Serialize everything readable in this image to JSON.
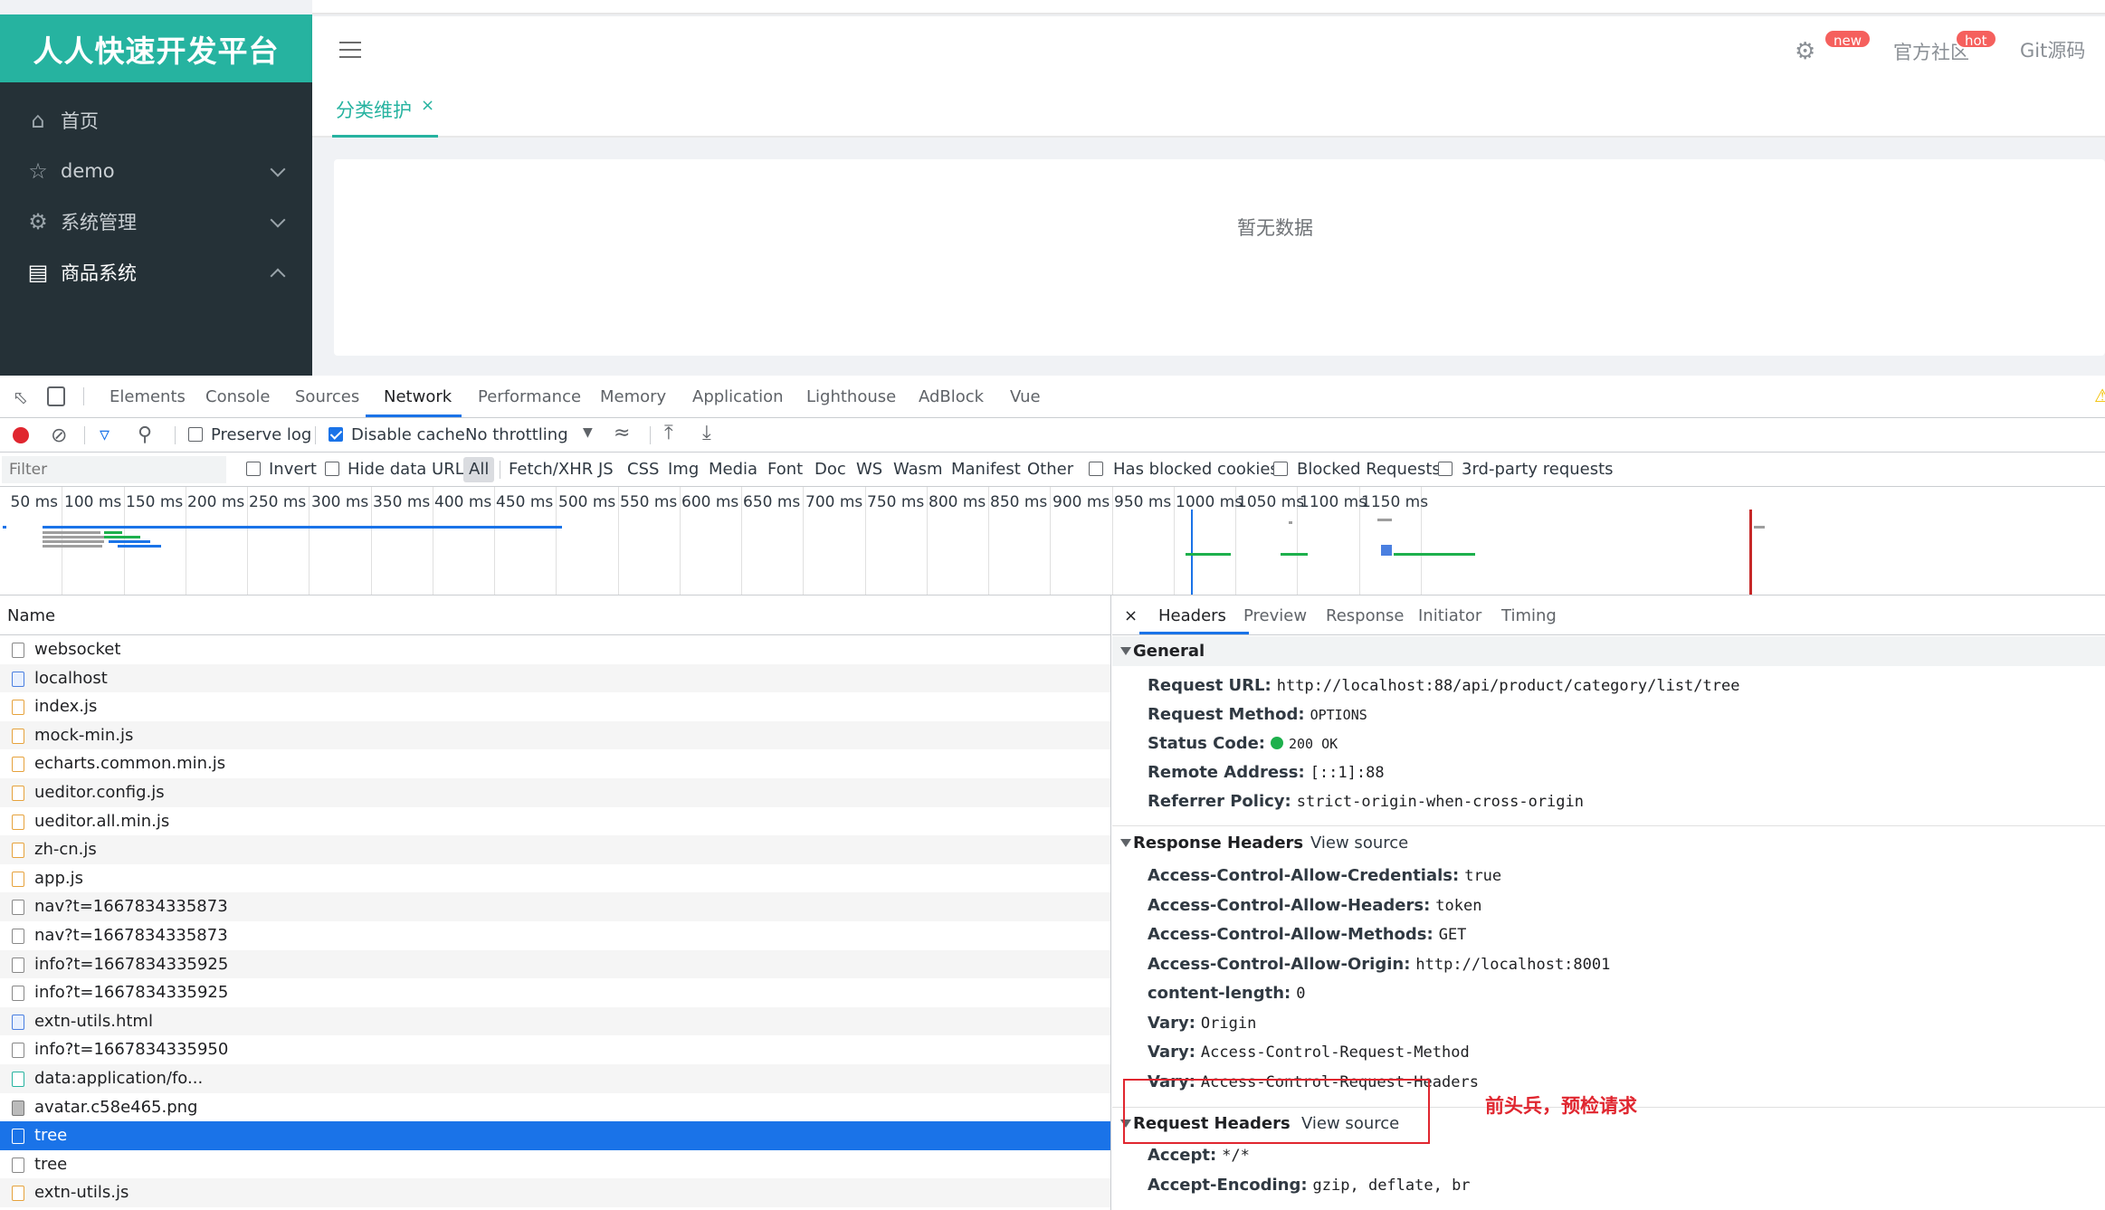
{
  "app": {
    "brand": "人人快速开发平台",
    "sidebar": [
      {
        "label": "首页",
        "icon": "home-icon"
      },
      {
        "label": "demo",
        "icon": "star-icon"
      },
      {
        "label": "系统管理",
        "icon": "gear-icon"
      },
      {
        "label": "商品系统",
        "icon": "list-icon"
      }
    ],
    "topbar": {
      "new_badge": "new",
      "community": "官方社区",
      "hot_badge": "hot",
      "git": "Git源码"
    },
    "tab": {
      "label": "分类维护",
      "close": "×"
    },
    "empty_text": "暂无数据"
  },
  "devtools": {
    "tabs": [
      "Elements",
      "Console",
      "Sources",
      "Network",
      "Performance",
      "Memory",
      "Application",
      "Lighthouse",
      "AdBlock",
      "Vue"
    ],
    "active_tab": "Network",
    "toolbar": {
      "preserve_log": "Preserve log",
      "preserve_log_checked": false,
      "disable_cache": "Disable cache",
      "disable_cache_checked": true,
      "throttling": "No throttling"
    },
    "filterbar": {
      "placeholder": "Filter",
      "invert": "Invert",
      "hide_data_urls": "Hide data URLs",
      "types": [
        "All",
        "Fetch/XHR",
        "JS",
        "CSS",
        "Img",
        "Media",
        "Font",
        "Doc",
        "WS",
        "Wasm",
        "Manifest",
        "Other"
      ],
      "has_blocked_cookies": "Has blocked cookies",
      "blocked_requests": "Blocked Requests",
      "third_party": "3rd-party requests"
    },
    "timeline_ticks": [
      "50 ms",
      "100 ms",
      "150 ms",
      "200 ms",
      "250 ms",
      "300 ms",
      "350 ms",
      "400 ms",
      "450 ms",
      "500 ms",
      "550 ms",
      "600 ms",
      "650 ms",
      "700 ms",
      "750 ms",
      "800 ms",
      "850 ms",
      "900 ms",
      "950 ms",
      "1000 ms",
      "1050 ms",
      "1100 ms",
      "1150 ms"
    ],
    "name_header": "Name",
    "requests": [
      {
        "name": "websocket",
        "type": "other"
      },
      {
        "name": "localhost",
        "type": "doc"
      },
      {
        "name": "index.js",
        "type": "js"
      },
      {
        "name": "mock-min.js",
        "type": "js"
      },
      {
        "name": "echarts.common.min.js",
        "type": "js"
      },
      {
        "name": "ueditor.config.js",
        "type": "js"
      },
      {
        "name": "ueditor.all.min.js",
        "type": "js"
      },
      {
        "name": "zh-cn.js",
        "type": "js"
      },
      {
        "name": "app.js",
        "type": "js"
      },
      {
        "name": "nav?t=1667834335873",
        "type": "other"
      },
      {
        "name": "nav?t=1667834335873",
        "type": "other"
      },
      {
        "name": "info?t=1667834335925",
        "type": "other"
      },
      {
        "name": "info?t=1667834335925",
        "type": "other"
      },
      {
        "name": "extn-utils.html",
        "type": "doc"
      },
      {
        "name": "info?t=1667834335950",
        "type": "other"
      },
      {
        "name": "data:application/fo...",
        "type": "font"
      },
      {
        "name": "avatar.c58e465.png",
        "type": "img"
      },
      {
        "name": "tree",
        "type": "other",
        "selected": true
      },
      {
        "name": "tree",
        "type": "other"
      },
      {
        "name": "extn-utils.js",
        "type": "js"
      }
    ],
    "detail_tabs": [
      "×",
      "Headers",
      "Preview",
      "Response",
      "Initiator",
      "Timing"
    ],
    "general": {
      "title": "General",
      "rows": [
        {
          "key": "Request URL:",
          "value": "http://localhost:88/api/product/category/list/tree"
        },
        {
          "key": "Request Method:",
          "value": "OPTIONS"
        },
        {
          "key": "Status Code:",
          "value": "200 OK"
        },
        {
          "key": "Remote Address:",
          "value": "[::1]:88"
        },
        {
          "key": "Referrer Policy:",
          "value": "strict-origin-when-cross-origin"
        }
      ]
    },
    "response_headers": {
      "title": "Response Headers",
      "view_source": "View source",
      "rows": [
        {
          "key": "Access-Control-Allow-Credentials:",
          "value": "true"
        },
        {
          "key": "Access-Control-Allow-Headers:",
          "value": "token"
        },
        {
          "key": "Access-Control-Allow-Methods:",
          "value": "GET"
        },
        {
          "key": "Access-Control-Allow-Origin:",
          "value": "http://localhost:8001"
        },
        {
          "key": "content-length:",
          "value": "0"
        },
        {
          "key": "Vary:",
          "value": "Origin"
        },
        {
          "key": "Vary:",
          "value": "Access-Control-Request-Method"
        },
        {
          "key": "Vary:",
          "value": "Access-Control-Request-Headers"
        }
      ]
    },
    "request_headers": {
      "title": "Request Headers",
      "view_source": "View source",
      "rows": [
        {
          "key": "Accept:",
          "value": "*/*"
        },
        {
          "key": "Accept-Encoding:",
          "value": "gzip, deflate, br"
        }
      ]
    },
    "annotation": "前头兵，预检请求",
    "colors": {
      "accent": "#1a73e8",
      "brand": "#26b3a0",
      "annotation": "#e0262f",
      "status_ok": "#1db04c"
    }
  }
}
